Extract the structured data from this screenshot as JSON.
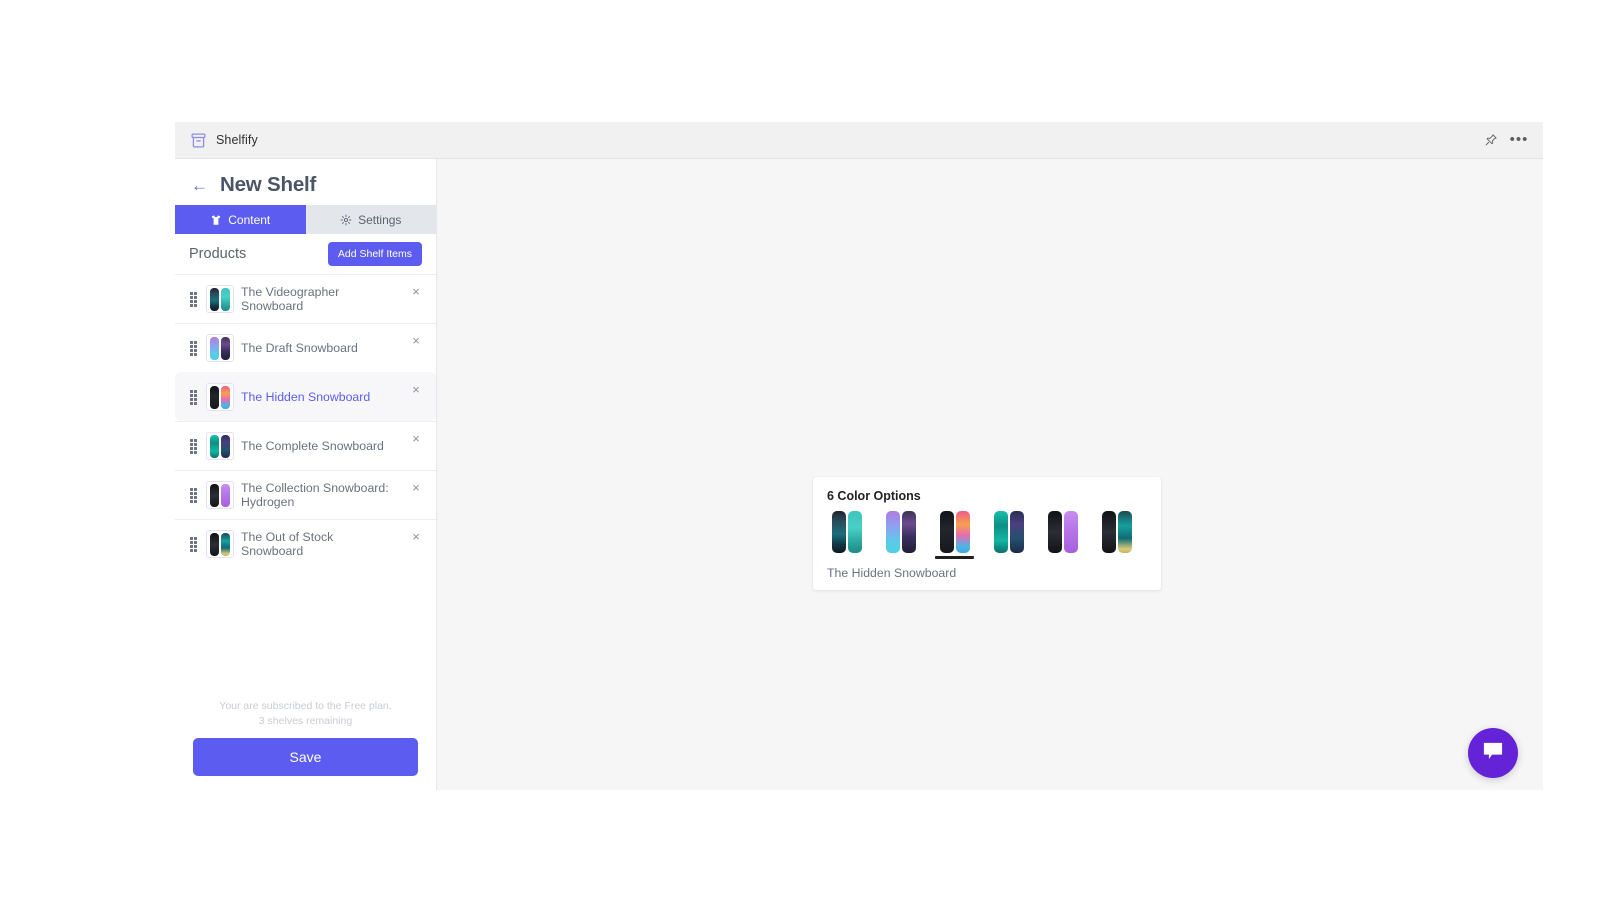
{
  "app": {
    "name": "Shelfify",
    "logo_icon": "archive-box-icon",
    "pin_icon": "pin-icon",
    "more_icon": "ellipsis-icon",
    "accent_color": "#5c5cf0",
    "canvas_bg": "#f6f6f7",
    "topbar_bg": "#f1f1f1"
  },
  "sidebar": {
    "back_icon": "arrow-left-icon",
    "title": "New Shelf",
    "tabs": [
      {
        "label": "Content",
        "icon": "tshirt-icon",
        "active": true
      },
      {
        "label": "Settings",
        "icon": "gear-icon",
        "active": false
      }
    ],
    "section_label": "Products",
    "add_button_label": "Add Shelf Items",
    "remove_icon": "close-icon",
    "drag_icon": "drag-handle-icon",
    "products": [
      {
        "name": "The Videographer Snowboard",
        "selected": false,
        "thumb": {
          "left": "linear-gradient(180deg,#1d2430 0%,#2a4e5a 25%,#1a6f7e 55%,#123642 80%,#0d1a22 100%)",
          "right": "linear-gradient(180deg,#3ec4bd 0%,#49cfc6 40%,#2aa69f 75%,#1d8b85 100%)"
        }
      },
      {
        "name": "The Draft Snowboard",
        "selected": false,
        "thumb": {
          "left": "linear-gradient(180deg,#b07ce0 0%,#8f9ff0 35%,#5fc8e8 70%,#49d2e6 100%)",
          "right": "linear-gradient(180deg,#3d3352 0%,#6b4b8f 30%,#3a3060 60%,#231c38 100%)"
        }
      },
      {
        "name": "The Hidden Snowboard",
        "selected": true,
        "thumb": {
          "left": "linear-gradient(180deg,#111317 0%,#23262c 45%,#16181c 100%)",
          "right": "linear-gradient(180deg,#f05a8a 0%,#f6a04e 32%,#e86bb0 58%,#47b6e8 85%,#3fa8e0 100%)"
        }
      },
      {
        "name": "The Complete Snowboard",
        "selected": false,
        "thumb": {
          "left": "linear-gradient(180deg,#16c0a8 0%,#0e8f86 35%,#14b7a4 70%,#0b6f68 100%)",
          "right": "linear-gradient(180deg,#2a2f55 0%,#4a3f80 30%,#25506e 65%,#1b2b4a 100%)"
        }
      },
      {
        "name": "The Collection Snowboard: Hydrogen",
        "selected": false,
        "thumb": {
          "left": "linear-gradient(180deg,#101215 0%,#2b2e34 50%,#111317 100%)",
          "right": "linear-gradient(180deg,#c88ef0 0%,#b675e8 45%,#a85fe0 100%)"
        }
      },
      {
        "name": "The Out of Stock Snowboard",
        "selected": false,
        "thumb": {
          "left": "linear-gradient(180deg,#101215 0%,#2b2e34 50%,#111317 100%)",
          "right": "linear-gradient(180deg,#1b4a52 0%,#17a0a0 35%,#0f6b74 65%,#d8c87a 90%,#c9b85e 100%)"
        }
      }
    ],
    "plan_line_1": "Your are subscribed to the Free plan.",
    "plan_line_2": "3 shelves remaining",
    "save_label": "Save"
  },
  "color_card": {
    "title": "6 Color Options",
    "caption": "The Hidden Snowboard",
    "options": [
      {
        "selected": false,
        "left": "linear-gradient(180deg,#1d2430 0%,#2a4e5a 25%,#1a6f7e 55%,#123642 80%,#0d1a22 100%)",
        "right": "linear-gradient(180deg,#3ec4bd 0%,#49cfc6 40%,#2aa69f 75%,#1d8b85 100%)"
      },
      {
        "selected": false,
        "left": "linear-gradient(180deg,#b07ce0 0%,#8f9ff0 35%,#5fc8e8 70%,#49d2e6 100%)",
        "right": "linear-gradient(180deg,#3d3352 0%,#6b4b8f 30%,#3a3060 60%,#231c38 100%)"
      },
      {
        "selected": true,
        "left": "linear-gradient(180deg,#111317 0%,#23262c 45%,#16181c 100%)",
        "right": "linear-gradient(180deg,#f05a8a 0%,#f6a04e 32%,#e86bb0 58%,#47b6e8 85%,#3fa8e0 100%)"
      },
      {
        "selected": false,
        "left": "linear-gradient(180deg,#16c0a8 0%,#0e8f86 35%,#14b7a4 70%,#0b6f68 100%)",
        "right": "linear-gradient(180deg,#2a2f55 0%,#4a3f80 30%,#25506e 65%,#1b2b4a 100%)"
      },
      {
        "selected": false,
        "left": "linear-gradient(180deg,#101215 0%,#2b2e34 50%,#111317 100%)",
        "right": "linear-gradient(180deg,#c88ef0 0%,#b675e8 45%,#a85fe0 100%)"
      },
      {
        "selected": false,
        "left": "linear-gradient(180deg,#101215 0%,#2b2e34 50%,#111317 100%)",
        "right": "linear-gradient(180deg,#1b4a52 0%,#17a0a0 35%,#0f6b74 65%,#d8c87a 90%,#c9b85e 100%)"
      }
    ]
  },
  "chat": {
    "icon": "chat-bubble-icon",
    "color": "#6423d6"
  }
}
